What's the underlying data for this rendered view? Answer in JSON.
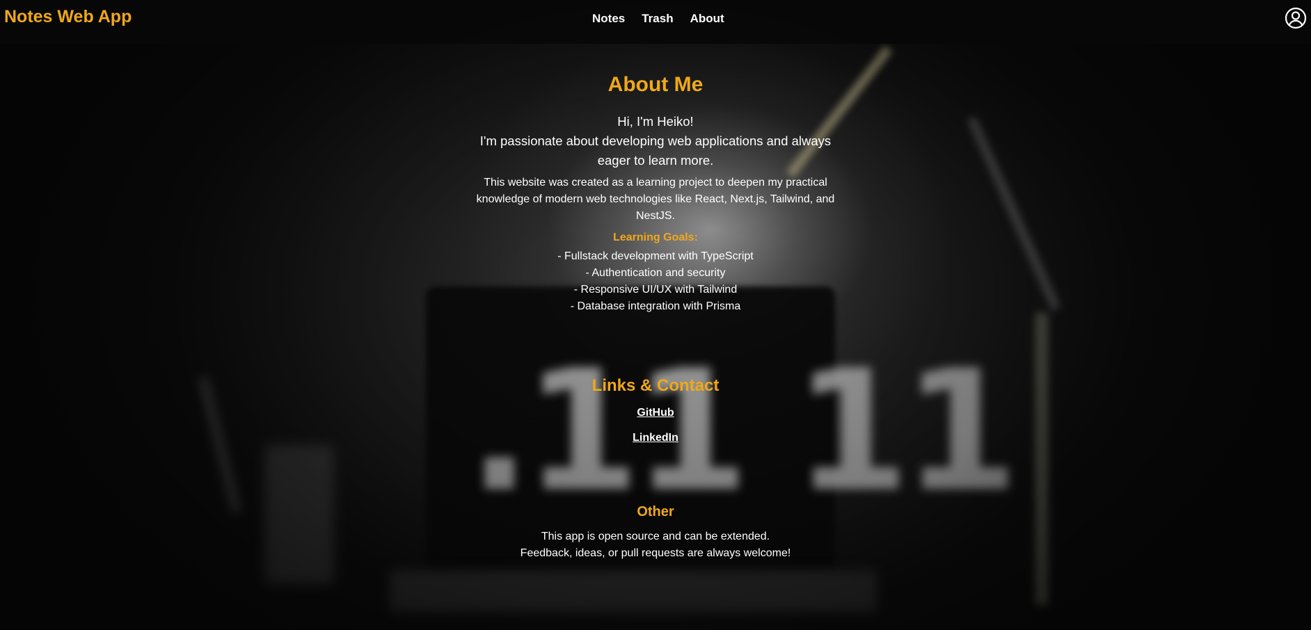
{
  "header": {
    "brand": "Notes Web App",
    "nav": [
      "Notes",
      "Trash",
      "About"
    ]
  },
  "about": {
    "title": "About Me",
    "intro_line1": "Hi, I'm Heiko!",
    "intro_line2": "I'm passionate about developing web applications and always eager to learn more.",
    "description": "This website was created as a learning project to deepen my practical knowledge of modern web technologies like React, Next.js, Tailwind, and NestJS.",
    "goals_title": "Learning Goals:",
    "goals": [
      "- Fullstack development with TypeScript",
      "- Authentication and security",
      "- Responsive UI/UX with Tailwind",
      "- Database integration with Prisma"
    ]
  },
  "links": {
    "title": "Links & Contact",
    "github": "GitHub",
    "linkedin": "LinkedIn"
  },
  "other": {
    "title": "Other",
    "line1": "This app is open source and can be extended.",
    "line2": "Feedback, ideas, or pull requests are always welcome!"
  },
  "colors": {
    "accent": "#f0a81a",
    "header_bg": "#080808",
    "text": "#ffffff"
  },
  "icons": {
    "account": "user-circle-icon"
  }
}
